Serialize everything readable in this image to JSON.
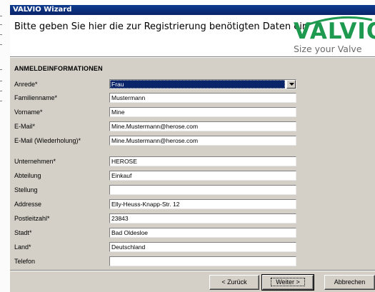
{
  "window": {
    "title": "VALVIO Wizard"
  },
  "header": {
    "instruction": "Bitte geben Sie hier die zur Registrierung benötigten Daten ein",
    "logo_name": "VALVIO",
    "logo_tagline": "Size your Valve",
    "colors": {
      "logo_green": "#1d9a4f",
      "tagline_gray": "#6b6b6b"
    }
  },
  "form": {
    "section_title": "ANMELDEINFORMATIONEN",
    "salutation": {
      "label": "Anrede*",
      "value": "Frau"
    },
    "last_name": {
      "label": "Familienname*",
      "value": "Mustermann"
    },
    "first_name": {
      "label": "Vorname*",
      "value": "Mine"
    },
    "email": {
      "label": "E-Mail*",
      "value": "Mine.Mustermann@herose.com"
    },
    "email_repeat": {
      "label": "E-Mail (Wiederholung)*",
      "value": "Mine.Mustermann@herose.com"
    },
    "company": {
      "label": "Unternehmen*",
      "value": "HEROSE"
    },
    "department": {
      "label": "Abteilung",
      "value": "Einkauf"
    },
    "position": {
      "label": "Stellung",
      "value": ""
    },
    "address": {
      "label": "Addresse",
      "value": "Elly-Heuss-Knapp-Str. 12"
    },
    "postal_code": {
      "label": "Postleitzahl*",
      "value": "23843"
    },
    "city": {
      "label": "Stadt*",
      "value": "Bad Oldesloe"
    },
    "country": {
      "label": "Land*",
      "value": "Deutschland"
    },
    "phone": {
      "label": "Telefon",
      "value": ""
    }
  },
  "buttons": {
    "back": "< Zurück",
    "next": "Weiter >",
    "cancel": "Abbrechen"
  },
  "icons": {
    "dropdown": "chevron-down-icon",
    "logo_arc": "arc-icon"
  }
}
